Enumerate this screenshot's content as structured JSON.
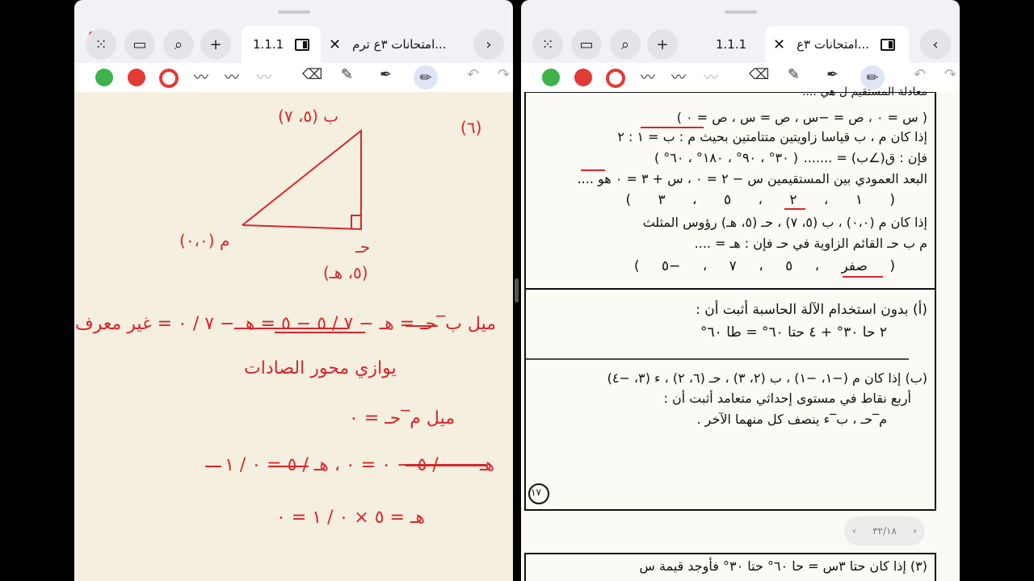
{
  "colors": {
    "ink_red": "#d8262a",
    "green": "#3cb44b",
    "red": "#e23a35",
    "ring": "#e23a35"
  },
  "left_tabs": {
    "active": "1.1.1",
    "other": "امتحانات ٣ع ترم..."
  },
  "right_tabs": {
    "active": "امتحانات ٣ع...",
    "other": "1.1.1"
  },
  "icons": {
    "grid": "dots-grid-icon",
    "sidebar": "sidebar-icon",
    "search": "search-icon",
    "add": "plus-icon",
    "back": "chevron-icon"
  },
  "left_notes": {
    "label_6": "(٦)",
    "vertex_b": "ب (٥، ٧)",
    "vertex_a": "(٠،٠) م",
    "vertex_c": "حـ",
    "vertex_c_coords": "(٥، هـ)",
    "line1": "ميل ب‾حـ = هـ − ٧ / ٥ − ٥ = هـ − ٧ / ٠ = غير معرف",
    "line2": "يوازي محور الصادات",
    "line3": "ميل م‾حـ = ٠",
    "line4": "هـ − ٠ / ٥ − ٠ = ٠ ، هـ / ٥ = ٠ / ١",
    "line5": "هـ = ٥ × ٠ / ١ = ٠"
  },
  "right_doc": {
    "q_top": "معادلة المستقيم ل هي ....",
    "q_top_opts": "( س = ٠ ، ص = −س ، ص = س ، ص = ٠ )",
    "q4": "إذا كان م ، ب قياسا زاويتين متتامتين بحيث م : ب = ١ : ٢",
    "q4b": "فإن : ق(∠ب) = .......",
    "q4_opts": "( ٣٠° ، ٩٠° ، ١٨٠° ، ٦٠° )",
    "q5": "البعد العمودي بين المستقيمين س − ٢ = ٠ ، س + ٣ = ٠ هو ....",
    "q5_opts": "( ١ ، ٢ ، ٥ ، ٣ )",
    "q6": "إذا كان م (٠،٠) ، ب (٥، ٧) ، حـ (٥، هـ) رؤوس المثلث",
    "q6b": "م ب حـ القائم الزاوية في حـ فإن : هـ = ....",
    "q6_opts": "( صفر ، ٥ ، ٧ ، −٥ )",
    "qa": "(أ) بدون استخدام الآلة الحاسبة أثبت أن :",
    "qa_eq": "٢ حا ٣٠° + ٤ حتا ٦٠° = طا ٦٠°",
    "qb": "(ب) إذا كان م (−١، −١) ، ب (٢، ٣) ، حـ (٦، ٢) ، ء (٣، −٤)",
    "qb2": "أربع نقاط في مستوى إحداثي متعامد أثبت أن :",
    "qb3": "م‾حـ ، ب‾ء ينصف كل منهما الآخر .",
    "page_num": "١٧",
    "pager": "٣٢/١٨",
    "q3_bottom": "(٣) إذا كان حتا ٣س = حا ٦٠° حتا ٣٠° فأوجد قيمة س"
  }
}
